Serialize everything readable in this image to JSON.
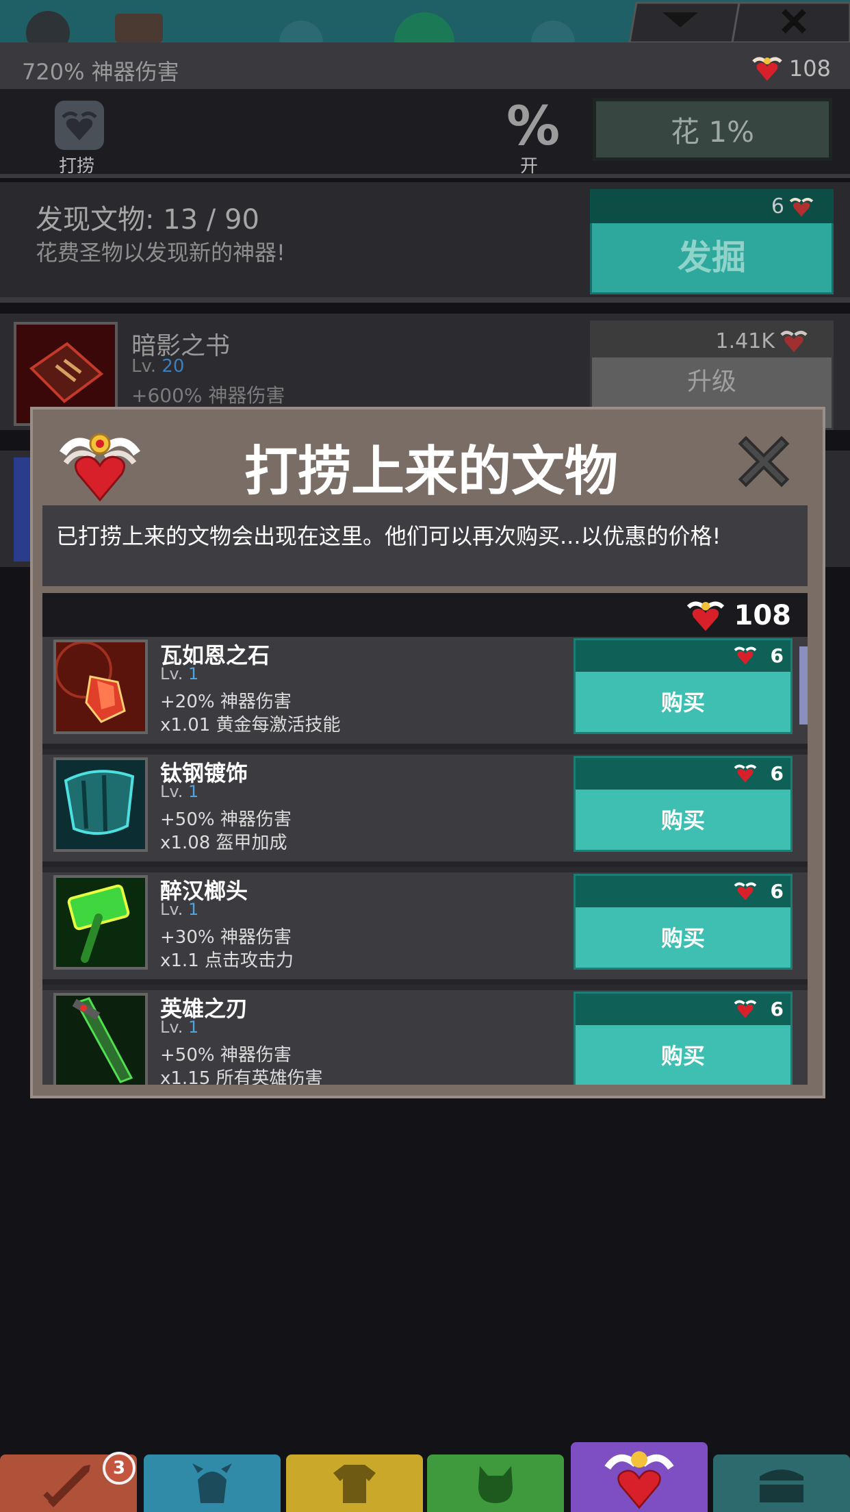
{
  "header": {
    "artifact_damage": "720% 神器伤害",
    "relic_count": "108"
  },
  "salvage": {
    "label": "打捞",
    "percent_icon_text": "%",
    "percent_label": "开",
    "spend_button": "花 1%"
  },
  "discover": {
    "title": "发现文物: 13 / 90",
    "subtitle": "花费圣物以发现新的神器!",
    "cost": "6",
    "button": "发掘"
  },
  "background_artifact": {
    "name": "暗影之书",
    "level_prefix": "Lv.",
    "level": "20",
    "bonus": "+600% 神器伤害",
    "upgrade_cost": "1.41K",
    "upgrade_label": "升级"
  },
  "modal": {
    "title": "打捞上来的文物",
    "description": "已打捞上来的文物会出现在这里。他们可以再次购买...以优惠的价格!",
    "balance": "108",
    "items": [
      {
        "name": "瓦如恩之石",
        "level_prefix": "Lv.",
        "level": "1",
        "bonus1": "+20% 神器伤害",
        "bonus2": "x1.01 黄金每激活技能",
        "cost": "6",
        "buy_label": "购买",
        "thumb_color": "#7a1a10",
        "accent": "#e0402a"
      },
      {
        "name": "钛钢镀饰",
        "level_prefix": "Lv.",
        "level": "1",
        "bonus1": "+50% 神器伤害",
        "bonus2": "x1.08 盔甲加成",
        "cost": "6",
        "buy_label": "购买",
        "thumb_color": "#0f3a3e",
        "accent": "#2fd0d0"
      },
      {
        "name": "醉汉榔头",
        "level_prefix": "Lv.",
        "level": "1",
        "bonus1": "+30% 神器伤害",
        "bonus2": "x1.1 点击攻击力",
        "cost": "6",
        "buy_label": "购买",
        "thumb_color": "#0e3a14",
        "accent": "#3fd63f"
      },
      {
        "name": "英雄之刃",
        "level_prefix": "Lv.",
        "level": "1",
        "bonus1": "+50% 神器伤害",
        "bonus2": "x1.15 所有英雄伤害",
        "cost": "6",
        "buy_label": "购买",
        "thumb_color": "#0f2a12",
        "accent": "#3fbf3f"
      }
    ]
  },
  "nav": {
    "sword_badge": "3"
  },
  "colors": {
    "teal_button": "#3fbfb2",
    "teal_dark": "#0f6158",
    "modal_frame": "#7a6d66",
    "heart_red": "#d8202a"
  }
}
